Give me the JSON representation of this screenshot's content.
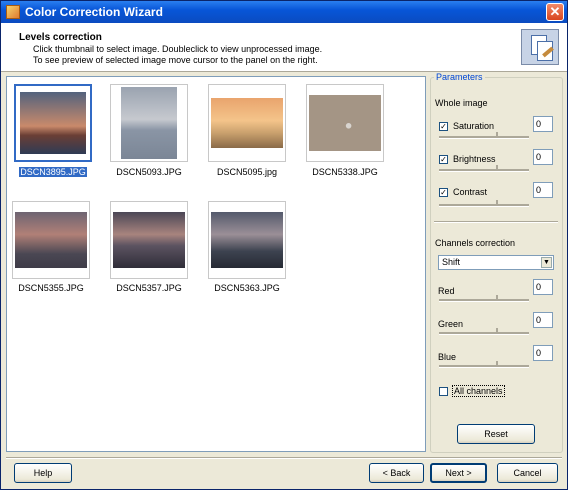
{
  "window": {
    "title": "Color Correction Wizard",
    "close_glyph": "✕"
  },
  "header": {
    "title": "Levels correction",
    "line1": "Click thumbnail to select image. Doubleclick to view unprocessed image.",
    "line2": "To see preview of selected image move cursor to the panel on the right.",
    "icon": "color-wizard-icon"
  },
  "thumbnails": [
    {
      "name": "DSCN3895.JPG",
      "selected": true
    },
    {
      "name": "DSCN5093.JPG",
      "selected": false
    },
    {
      "name": "DSCN5095.jpg",
      "selected": false
    },
    {
      "name": "DSCN5338.JPG",
      "selected": false
    },
    {
      "name": "DSCN5355.JPG",
      "selected": false
    },
    {
      "name": "DSCN5357.JPG",
      "selected": false
    },
    {
      "name": "DSCN5363.JPG",
      "selected": false
    }
  ],
  "params": {
    "legend": "Parameters",
    "whole_image": "Whole image",
    "saturation": {
      "label": "Saturation",
      "checked": true,
      "value": "0"
    },
    "brightness": {
      "label": "Brightness",
      "checked": true,
      "value": "0"
    },
    "contrast": {
      "label": "Contrast",
      "checked": true,
      "value": "0"
    },
    "channels_correction": "Channels correction",
    "mode": "Shift",
    "red": {
      "label": "Red",
      "value": "0"
    },
    "green": {
      "label": "Green",
      "value": "0"
    },
    "blue": {
      "label": "Blue",
      "value": "0"
    },
    "all_channels": {
      "label": "All channels",
      "checked": false
    },
    "reset": "Reset",
    "check_glyph": "✓",
    "dropdown_glyph": "▼"
  },
  "buttons": {
    "help": "Help",
    "back": "< Back",
    "next": "Next >",
    "cancel": "Cancel"
  }
}
